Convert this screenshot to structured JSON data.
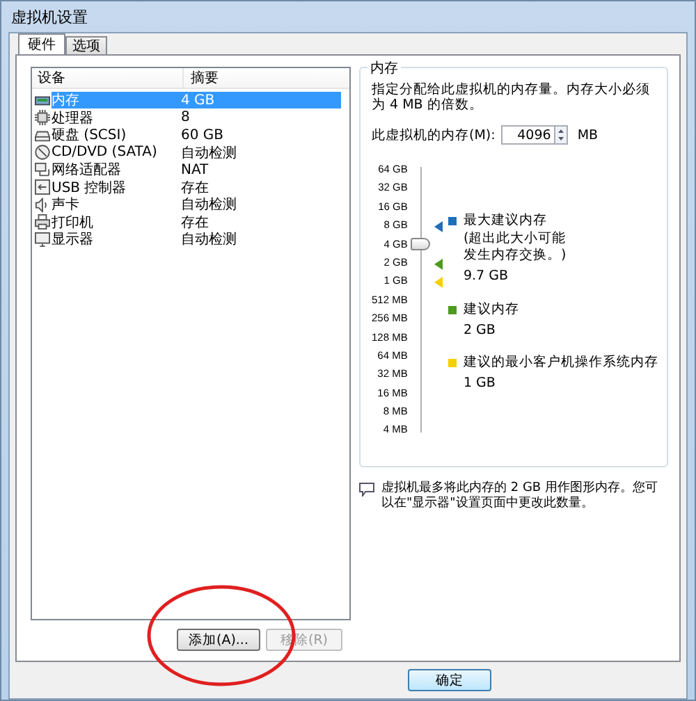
{
  "window": {
    "title": "虚拟机设置"
  },
  "tabs": [
    {
      "label": "硬件",
      "selected": true
    },
    {
      "label": "选项",
      "selected": false
    }
  ],
  "devices": {
    "columns": [
      "设备",
      "摘要"
    ],
    "rows": [
      {
        "kind": "memory",
        "name": "内存",
        "summary": "4 GB",
        "selected": true
      },
      {
        "kind": "cpu",
        "name": "处理器",
        "summary": "8",
        "selected": false
      },
      {
        "kind": "disk",
        "name": "硬盘 (SCSI)",
        "summary": "60 GB",
        "selected": false
      },
      {
        "kind": "cdrom",
        "name": "CD/DVD (SATA)",
        "summary": "自动检测",
        "selected": false
      },
      {
        "kind": "network",
        "name": "网络适配器",
        "summary": "NAT",
        "selected": false
      },
      {
        "kind": "usb",
        "name": "USB 控制器",
        "summary": "存在",
        "selected": false
      },
      {
        "kind": "sound",
        "name": "声卡",
        "summary": "自动检测",
        "selected": false
      },
      {
        "kind": "printer",
        "name": "打印机",
        "summary": "存在",
        "selected": false
      },
      {
        "kind": "display",
        "name": "显示器",
        "summary": "自动检测",
        "selected": false
      }
    ]
  },
  "device_buttons": [
    {
      "label": "添加(A)...",
      "disabled": false
    },
    {
      "label": "移除(R)",
      "disabled": true
    }
  ],
  "memory": {
    "title": "内存",
    "description": "指定分配给此虚拟机的内存量。内存大小必须为 4 MB 的倍数。",
    "field_label": "此虚拟机的内存(M):",
    "value": "4096",
    "unit": "MB",
    "scale": [
      "64 GB",
      "32 GB",
      "16 GB",
      "8 GB",
      "4 GB",
      "2 GB",
      "1 GB",
      "512 MB",
      "256 MB",
      "128 MB",
      "64 MB",
      "32 MB",
      "16 MB",
      "8 MB",
      "4 MB"
    ],
    "slider": {
      "level": 0.714
    },
    "legend": [
      {
        "title": "最大建议内存",
        "note": "(超出此大小可能发生内存交换。)",
        "value": "9.7 GB",
        "color": "#1f6fb8"
      },
      {
        "title": "建议内存",
        "value": "2 GB",
        "color": "#4e9a1e"
      },
      {
        "title": "建议的最小客户机操作系统内存",
        "value": "1 GB",
        "color": "#f5d000"
      }
    ]
  },
  "note": "虚拟机最多将此内存的 2 GB 用作图形内存。您可以在\"显示器\"设置页面中更改此数量。",
  "buttons": [
    "确定"
  ],
  "annotation": {
    "kind": "ellipse",
    "color": "#e02020"
  }
}
